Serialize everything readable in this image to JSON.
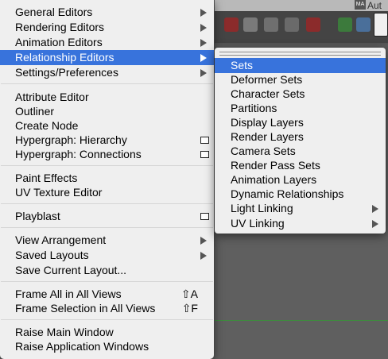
{
  "app": {
    "title": "Aut",
    "logo_text": "MA"
  },
  "main_menu": {
    "items": [
      {
        "label": "General Editors",
        "submenu": true
      },
      {
        "label": "Rendering Editors",
        "submenu": true
      },
      {
        "label": "Animation Editors",
        "submenu": true
      },
      {
        "label": "Relationship Editors",
        "submenu": true,
        "selected": true
      },
      {
        "label": "Settings/Preferences",
        "submenu": true
      },
      {
        "label": "Attribute Editor"
      },
      {
        "label": "Outliner"
      },
      {
        "label": "Create Node"
      },
      {
        "label": "Hypergraph: Hierarchy",
        "option_box": true
      },
      {
        "label": "Hypergraph: Connections",
        "option_box": true
      },
      {
        "label": "Paint Effects"
      },
      {
        "label": "UV Texture Editor"
      },
      {
        "label": "Playblast",
        "option_box": true
      },
      {
        "label": "View Arrangement",
        "submenu": true
      },
      {
        "label": "Saved Layouts",
        "submenu": true
      },
      {
        "label": "Save Current Layout..."
      },
      {
        "label": "Frame All in All Views",
        "shortcut": "⇧A"
      },
      {
        "label": "Frame Selection in All Views",
        "shortcut": "⇧F"
      },
      {
        "label": "Raise Main Window"
      },
      {
        "label": "Raise Application Windows"
      }
    ]
  },
  "sub_menu": {
    "items": [
      {
        "label": "Sets",
        "selected": true
      },
      {
        "label": "Deformer Sets"
      },
      {
        "label": "Character Sets"
      },
      {
        "label": "Partitions"
      },
      {
        "label": "Display Layers"
      },
      {
        "label": "Render Layers"
      },
      {
        "label": "Camera Sets"
      },
      {
        "label": "Render Pass Sets"
      },
      {
        "label": "Animation Layers"
      },
      {
        "label": "Dynamic Relationships"
      },
      {
        "label": "Light Linking",
        "submenu": true
      },
      {
        "label": "UV Linking",
        "submenu": true
      }
    ]
  },
  "colors": {
    "selection": "#3873dc",
    "menu_bg": "#f4f4f4"
  }
}
